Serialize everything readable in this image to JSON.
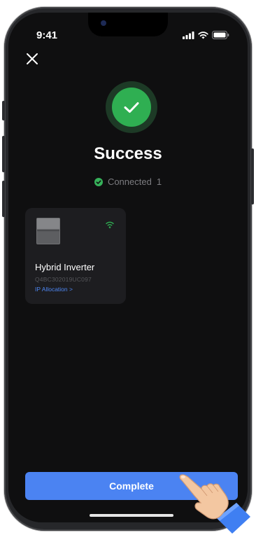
{
  "status_bar": {
    "time": "9:41"
  },
  "success": {
    "title": "Success"
  },
  "connection": {
    "label": "Connected",
    "count": "1"
  },
  "device": {
    "name": "Hybrid Inverter",
    "serial": "Q4BC302019UC097",
    "link_label": "IP Allocation >"
  },
  "footer": {
    "complete_label": "Complete"
  },
  "colors": {
    "accent": "#4b83f2",
    "success": "#2faf52",
    "background": "#0f0f10",
    "card": "#1d1d20"
  },
  "icons": [
    "close-icon",
    "checkmark-icon",
    "wifi-icon",
    "signal-icon",
    "battery-icon",
    "pointer-hand-icon"
  ]
}
